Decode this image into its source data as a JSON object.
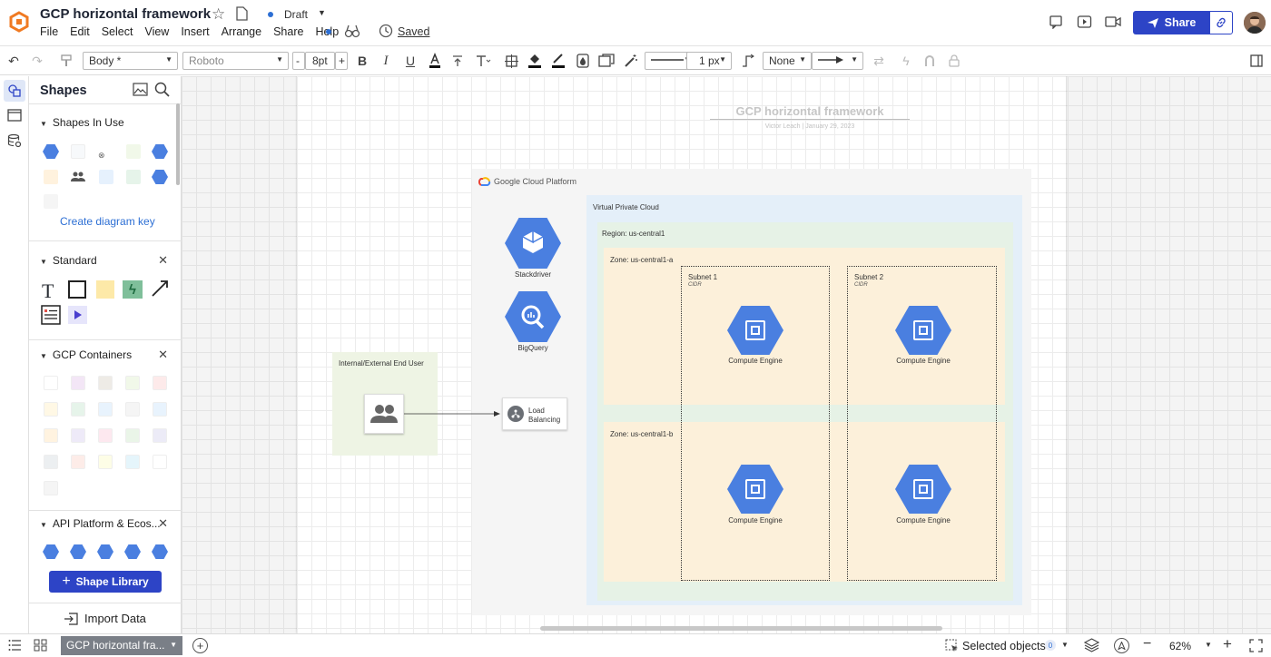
{
  "header": {
    "doc_title": "GCP horizontal framework",
    "status": "Draft",
    "menu": [
      "File",
      "Edit",
      "Select",
      "View",
      "Insert",
      "Arrange",
      "Share",
      "Help"
    ],
    "saved": "Saved",
    "share_label": "Share",
    "brand_color": "#2d44c6"
  },
  "toolbar": {
    "style_select": "Body *",
    "font_select": "Roboto",
    "font_size": "8pt",
    "minus": "-",
    "plus": "+",
    "bold": "B",
    "italic": "I",
    "underline": "U",
    "line_width": "1 px",
    "arrow_start": "None"
  },
  "panel": {
    "title": "Shapes",
    "sections": {
      "in_use": "Shapes In Use",
      "standard": "Standard",
      "gcp_containers": "GCP Containers",
      "api_platform": "API Platform & Ecos..."
    },
    "create_key": "Create diagram key",
    "shape_library": "Shape Library",
    "import_data": "Import Data",
    "container_colors": [
      "#ffffff",
      "#f3e6f6",
      "#eeebe6",
      "#f1f8e9",
      "#fdeaea",
      "#fff8e5",
      "#e6f4ea",
      "#e8f3fd",
      "#f5f5f5",
      "#e8f3fd",
      "#fff3e0",
      "#eeeaf8",
      "#fde8ef",
      "#eaf5e8",
      "#ecebf7",
      "#eceff1",
      "#fdece8",
      "#fdfde6",
      "#e5f5fb",
      "#ffffff",
      "#f5f5f5"
    ]
  },
  "diagram": {
    "title": "GCP horizontal framework",
    "subtitle": "Victor Leach  |  January 29, 2023",
    "gcp_logo": "Google Cloud Platform",
    "vpc": "Virtual Private Cloud",
    "region": "Region: us-central1",
    "zone_a": "Zone: us-central1-a",
    "zone_b": "Zone: us-central1-b",
    "subnet1": "Subnet 1",
    "subnet2": "Subnet 2",
    "cidr": "CIDR",
    "stackdriver": "Stackdriver",
    "bigquery": "BigQuery",
    "end_user": "Internal/External End User",
    "load_balancing": "Load Balancing",
    "compute_engine": "Compute Engine",
    "hex_color": "#4a7fe0"
  },
  "bottom": {
    "page_tab": "GCP horizontal fra...",
    "selected_objects": "Selected objects",
    "selected_count": "0",
    "zoom": "62%",
    "zoom_minus": "−",
    "zoom_plus": "+"
  }
}
